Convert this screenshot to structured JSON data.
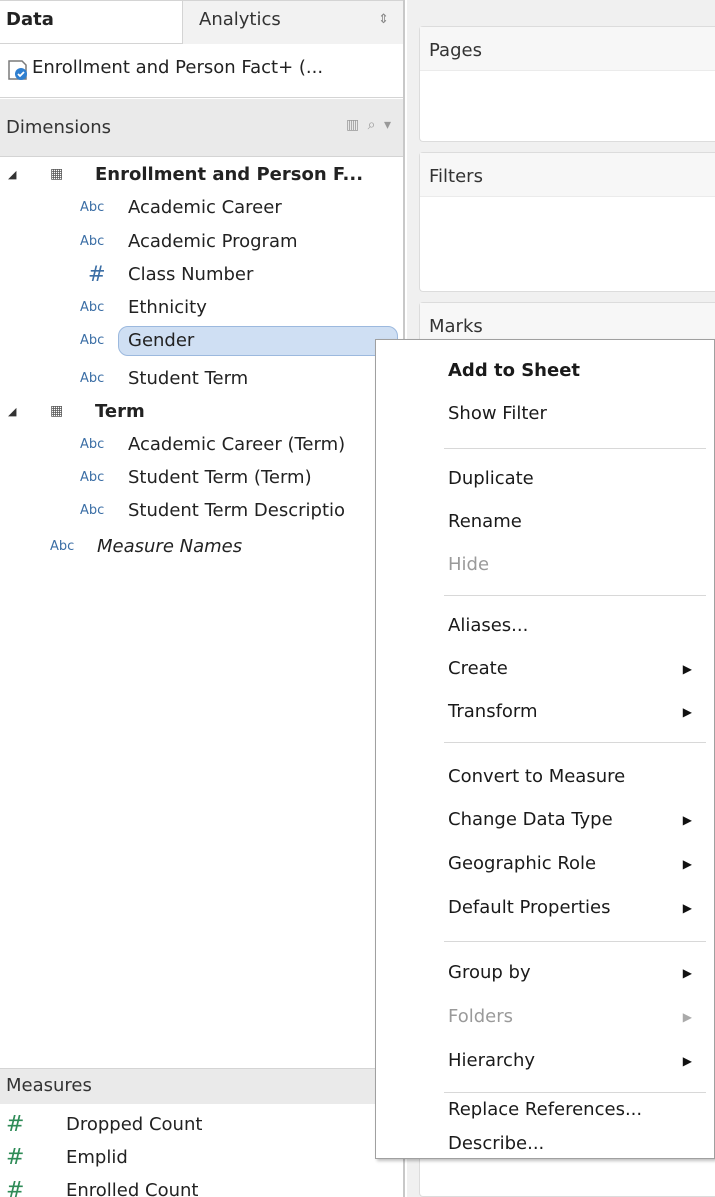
{
  "tabs": {
    "data": "Data",
    "analytics": "Analytics",
    "analytics_arrows": "⇕"
  },
  "datasource": {
    "label": "Enrollment and Person Fact+ (..."
  },
  "dimensions": {
    "header": "Dimensions",
    "tools": "▥ ⌕ ▾",
    "groups": [
      {
        "label": "Enrollment and Person F...",
        "fields": [
          {
            "type": "Abc",
            "label": "Academic Career"
          },
          {
            "type": "Abc",
            "label": "Academic Program"
          },
          {
            "type": "#",
            "label": "Class Number"
          },
          {
            "type": "Abc",
            "label": "Ethnicity"
          },
          {
            "type": "Abc",
            "label": "Gender"
          },
          {
            "type": "Abc",
            "label": "Student Term"
          }
        ]
      },
      {
        "label": "Term",
        "fields": [
          {
            "type": "Abc",
            "label": "Academic Career (Term)"
          },
          {
            "type": "Abc",
            "label": "Student Term (Term)"
          },
          {
            "type": "Abc",
            "label": "Student Term Descriptio"
          }
        ]
      }
    ],
    "measure_names": {
      "type": "Abc",
      "label": "Measure Names"
    }
  },
  "measures": {
    "header": "Measures",
    "items": [
      {
        "type": "#",
        "label": "Dropped Count"
      },
      {
        "type": "#",
        "label": "Emplid"
      },
      {
        "type": "#",
        "label": "Enrolled Count"
      }
    ]
  },
  "shelves": {
    "pages": "Pages",
    "filters": "Filters",
    "marks": "Marks"
  },
  "context_menu": {
    "items": [
      {
        "label": "Add to Sheet",
        "bold": true
      },
      {
        "label": "Show Filter"
      },
      {
        "label": "Duplicate"
      },
      {
        "label": "Rename"
      },
      {
        "label": "Hide",
        "disabled": true
      },
      {
        "label": "Aliases..."
      },
      {
        "label": "Create",
        "submenu": true
      },
      {
        "label": "Transform",
        "submenu": true
      },
      {
        "label": "Convert to Measure"
      },
      {
        "label": "Change Data Type",
        "submenu": true
      },
      {
        "label": "Geographic Role",
        "submenu": true
      },
      {
        "label": "Default Properties",
        "submenu": true
      },
      {
        "label": "Group by",
        "submenu": true
      },
      {
        "label": "Folders",
        "submenu": true,
        "disabled": true
      },
      {
        "label": "Hierarchy",
        "submenu": true
      },
      {
        "label": "Replace References..."
      },
      {
        "label": "Describe..."
      }
    ],
    "submenu_arrow": "▶"
  },
  "colors": {
    "selection_fill": "#cfdff3",
    "dimension_icon": "#3b6ea5",
    "measure_icon": "#2e8b57"
  }
}
